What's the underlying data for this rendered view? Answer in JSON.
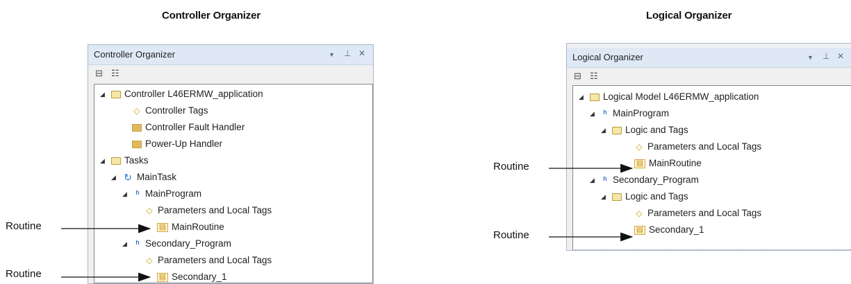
{
  "headings": {
    "left": "Controller Organizer",
    "right": "Logical Organizer"
  },
  "left_panel": {
    "title": "Controller Organizer",
    "controls": {
      "dropdown": "▼",
      "pin": "⊥",
      "close": "✕"
    },
    "tree": [
      {
        "label": "Controller L46ERMW_application",
        "icon": "folder-open-icon",
        "expander": "◢"
      },
      {
        "label": "Controller Tags",
        "icon": "tag-icon"
      },
      {
        "label": "Controller Fault Handler",
        "icon": "folder-icon"
      },
      {
        "label": "Power-Up Handler",
        "icon": "folder-icon"
      },
      {
        "label": "Tasks",
        "icon": "folder-open-icon",
        "expander": "◢"
      },
      {
        "label": "MainTask",
        "icon": "task-icon",
        "expander": "◢"
      },
      {
        "label": "MainProgram",
        "icon": "program-icon",
        "expander": "◢"
      },
      {
        "label": "Parameters and Local Tags",
        "icon": "tag-icon"
      },
      {
        "label": "MainRoutine",
        "icon": "routine-icon"
      },
      {
        "label": "Secondary_Program",
        "icon": "program-icon",
        "expander": "◢"
      },
      {
        "label": "Parameters and Local Tags",
        "icon": "tag-icon"
      },
      {
        "label": "Secondary_1",
        "icon": "routine-icon"
      }
    ]
  },
  "right_panel": {
    "title": "Logical Organizer",
    "controls": {
      "dropdown": "▼",
      "pin": "⊥",
      "close": "✕"
    },
    "tree": [
      {
        "label": "Logical Model L46ERMW_application",
        "icon": "folder-open-icon",
        "expander": "◢"
      },
      {
        "label": "MainProgram",
        "icon": "program-icon",
        "expander": "◢"
      },
      {
        "label": "Logic and Tags",
        "icon": "folder-open-icon",
        "expander": "◢"
      },
      {
        "label": "Parameters and Local Tags",
        "icon": "tag-icon"
      },
      {
        "label": "MainRoutine",
        "icon": "routine-icon"
      },
      {
        "label": "Secondary_Program",
        "icon": "program-icon",
        "expander": "◢"
      },
      {
        "label": "Logic and Tags",
        "icon": "folder-open-icon",
        "expander": "◢"
      },
      {
        "label": "Parameters and Local Tags",
        "icon": "tag-icon"
      },
      {
        "label": "Secondary_1",
        "icon": "routine-icon"
      }
    ]
  },
  "callouts": {
    "left_1": "Routine",
    "left_2": "Routine",
    "right_1": "Routine",
    "right_2": "Routine"
  },
  "colors": {
    "titlebar": "#dfe9f5",
    "panel_border": "#a9b7c9",
    "tree_border": "#828790"
  }
}
